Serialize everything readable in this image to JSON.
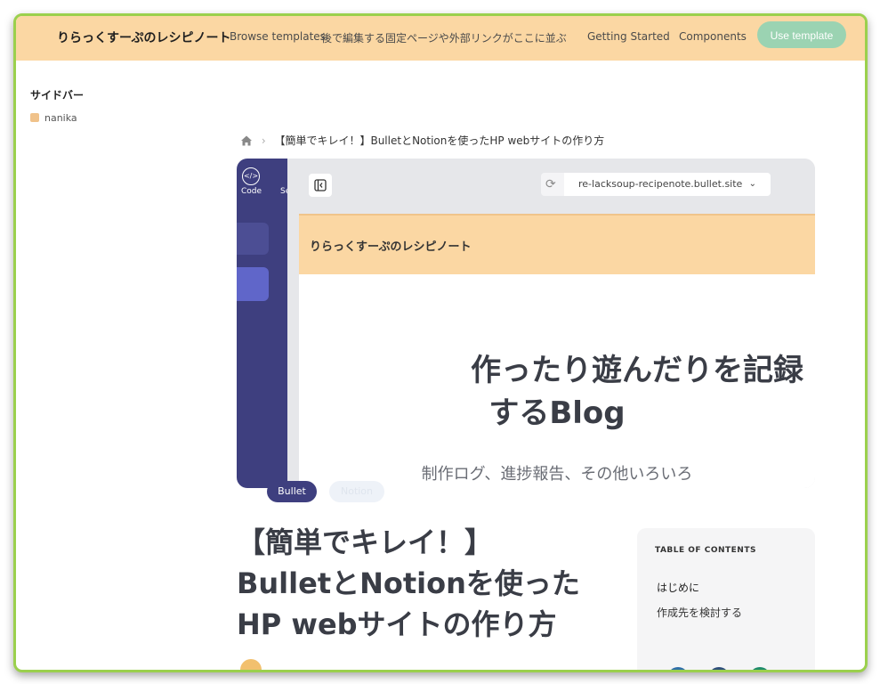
{
  "header": {
    "site_name": "りらっくすーぷのレシピノート",
    "nav": [
      "Browse templates",
      "後で編集する固定ページや外部リンクがここに並ぶ",
      "Getting Started",
      "Components"
    ],
    "cta": "Use template",
    "bg_color": "#fbd7a3",
    "cta_color": "#9bd3b2"
  },
  "sidebar": {
    "title": "サイドバー",
    "items": [
      {
        "label": "nanika"
      }
    ]
  },
  "breadcrumb": {
    "home_icon": "home-icon",
    "current": "【簡単でキレイ！】BulletとNotionを使ったHP webサイトの作り方"
  },
  "cover": {
    "left_panel": {
      "code_label": "Code",
      "next_label": "Se",
      "icon": "code-icon"
    },
    "url": "re-lacksoup-recipenote.bullet.site",
    "inner_site_name": "りらっくすーぷのレシピノート",
    "heading_line1": "作ったり遊んだりを記録",
    "heading_line2": "するBlog",
    "subheading": "制作ログ、進捗報告、その他いろいろ"
  },
  "tags": [
    "Bullet",
    "Notion"
  ],
  "post": {
    "title_lines": [
      "【簡単でキレイ！】",
      "BulletとNotionを使った",
      "HP webサイトの作り方"
    ]
  },
  "toc": {
    "title": "TABLE OF CONTENTS",
    "items": [
      "はじめに",
      "作成先を検討する"
    ]
  },
  "colors": {
    "frame_border": "#9bd04d",
    "dark_panel": "#3e3f7f",
    "tag_bullet": "#3e3f7f",
    "heading_text": "#3a3d46"
  }
}
